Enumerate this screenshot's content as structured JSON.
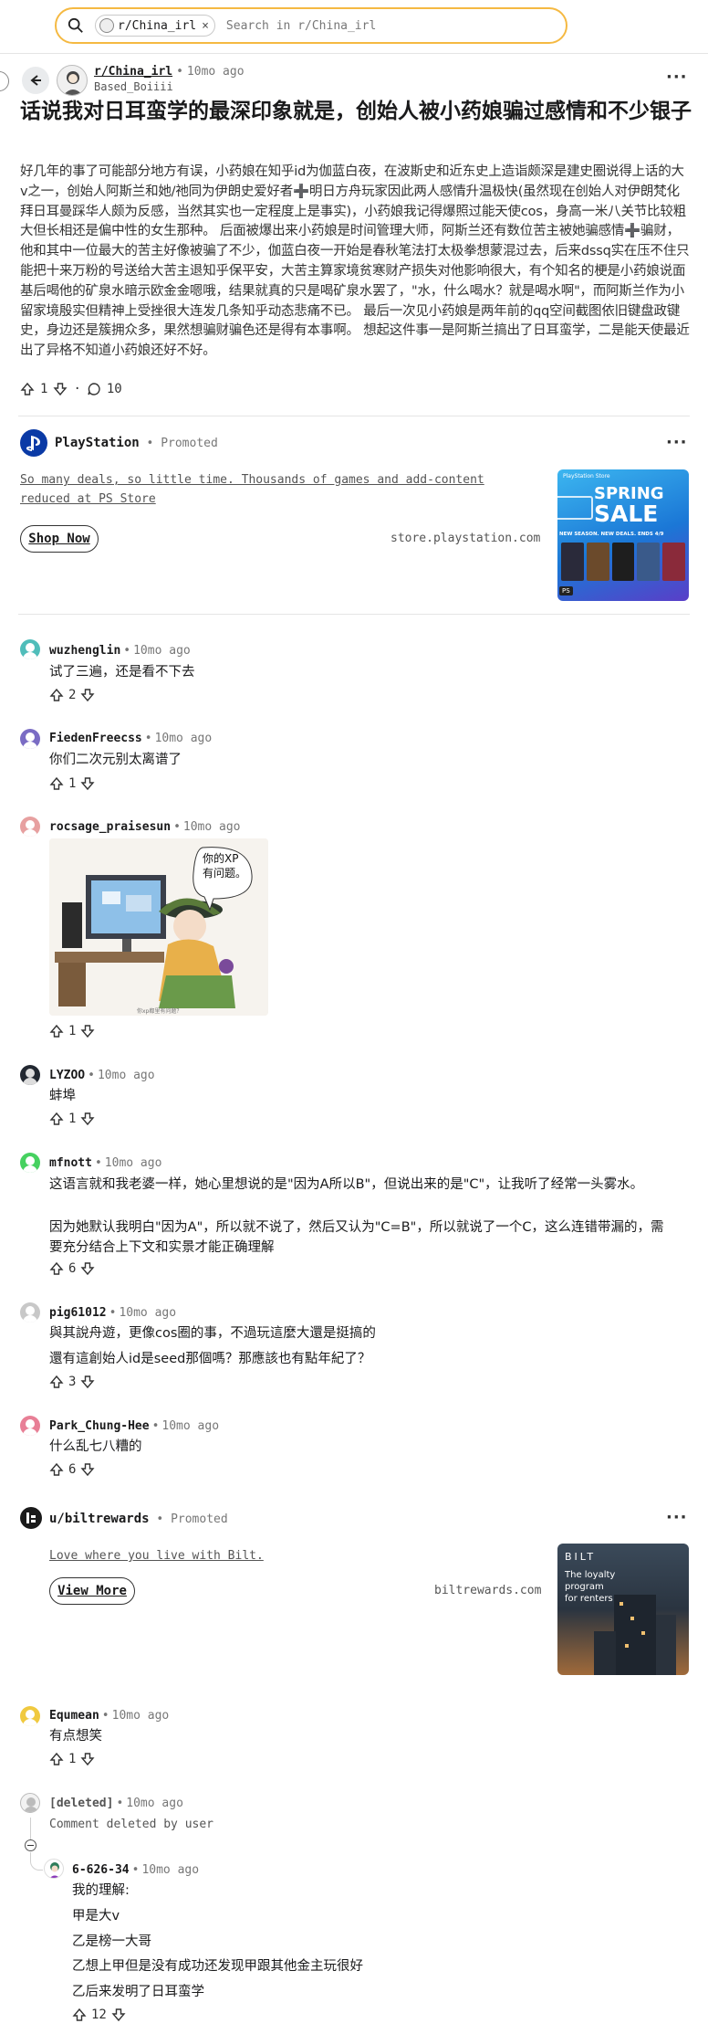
{
  "search": {
    "chip_label": "r/China_irl",
    "chip_close": "×",
    "placeholder": "Search in r/China_irl"
  },
  "post": {
    "subreddit": "r/China_irl",
    "time": "10mo ago",
    "author": "Based_Boiiii",
    "title": "话说我对日耳蛮学的最深印象就是，创始人被小药娘骗过感情和不少银子",
    "body": "好几年的事了可能部分地方有误，小药娘在知乎id为伽蓝白夜，在波斯史和近东史上造诣颇深是建史圈说得上话的大v之一，创始人阿斯兰和她/祂同为伊朗史爱好者➕明日方舟玩家因此两人感情升温极快(虽然现在创始人对伊朗梵化拜日耳曼踩华人颇为反感，当然其实也一定程度上是事实)，小药娘我记得爆照过能天使cos，身高一米八关节比较粗大但长相还是偏中性的女生那种。 后面被爆出来小药娘是时间管理大师，阿斯兰还有数位苦主被她骗感情➕骗财，他和其中一位最大的苦主好像被骗了不少，伽蓝白夜一开始是春秋笔法打太极拳想蒙混过去，后来dssq实在压不住只能把十来万粉的号送给大苦主退知乎保平安，大苦主算家境贫寒财产损失对他影响很大，有个知名的梗是小药娘说面基后喝他的矿泉水暗示欧金金嗯哦，结果就真的只是喝矿泉水罢了，\"水，什么喝水？就是喝水啊\"，而阿斯兰作为小留家境殷实但精神上受挫很大连发几条知乎动态悲痛不已。 最后一次见小药娘是两年前的qq空间截图依旧键盘政键史，身边还是簇拥众多，果然想骗财骗色还是得有本事啊。 想起这件事一是阿斯兰搞出了日耳蛮学，二是能天使最近出了异格不知道小药娘还好不好。",
    "upvotes": "1",
    "comments": "10",
    "separator": "·"
  },
  "ad_playstation": {
    "name": "PlayStation",
    "promoted": "Promoted",
    "text": "So many deals, so little time. Thousands of games and add-content reduced at PS Store",
    "button": "Shop Now",
    "domain": "store.playstation.com",
    "image": {
      "brand": "PlayStation Store",
      "headline_top": "SPRING",
      "headline_bottom": "SALE",
      "tag": "NEW SEASON. NEW DEALS. ENDS 4/9",
      "badge": "PS"
    }
  },
  "comments": [
    {
      "user": "wuzhenglin",
      "time": "10mo ago",
      "lines": [
        "试了三遍，还是看不下去"
      ],
      "votes": "2",
      "avatar_color": "#4fbdba"
    },
    {
      "user": "FiedenFreecss",
      "time": "10mo ago",
      "lines": [
        "你们二次元别太离谱了"
      ],
      "votes": "1",
      "avatar_color": "#7a6cc4"
    },
    {
      "user": "rocsage_praisesun",
      "time": "10mo ago",
      "lines": [],
      "votes": "1",
      "avatar_color": "#e7a0a0",
      "image_caption": "你的XP有问题。",
      "image_footer": "你xp都里有问题？"
    },
    {
      "user": "LYZOO",
      "time": "10mo ago",
      "lines": [
        "蚌埠"
      ],
      "votes": "1",
      "avatar_color": "#222831"
    },
    {
      "user": "mfnott",
      "time": "10mo ago",
      "lines": [
        "这语言就和我老婆一样，她心里想说的是\"因为A所以B\"，但说出来的是\"C\"，让我听了经常一头雾水。",
        "因为她默认我明白\"因为A\"，所以就不说了，然后又认为\"C=B\"，所以就说了一个C，这么连错带漏的，需要充分结合上下文和实景才能正确理解"
      ],
      "votes": "6",
      "avatar_color": "#46d160"
    },
    {
      "user": "pig61012",
      "time": "10mo ago",
      "lines": [
        "與其說舟遊，更像cos圈的事，不過玩這麼大還是挺搞的",
        "還有這創始人id是seed那個嗎？那應該也有點年紀了？"
      ],
      "votes": "3",
      "avatar_color": "#c8c8c8"
    },
    {
      "user": "Park_Chung-Hee",
      "time": "10mo ago",
      "lines": [
        "什么乱七八糟的"
      ],
      "votes": "6",
      "avatar_color": "#e87f96"
    }
  ],
  "ad_bilt": {
    "name": "u/biltrewards",
    "promoted": "Promoted",
    "text": "Love where you live with Bilt.",
    "button": "View More",
    "domain": "biltrewards.com",
    "image": {
      "brand": "BILT",
      "line1": "The loyalty",
      "line2": "program",
      "line3": "for renters"
    }
  },
  "comments2": [
    {
      "user": "Equmean",
      "time": "10mo ago",
      "lines": [
        "有点想笑"
      ],
      "votes": "1",
      "avatar_color": "#f0c93f"
    },
    {
      "user": "[deleted]",
      "time": "10mo ago",
      "lines": [
        "Comment deleted by user"
      ],
      "votes": "",
      "avatar_color": "#d9d9d9"
    },
    {
      "user": "6-626-34",
      "time": "10mo ago",
      "lines": [
        "我的理解:",
        "甲是大v",
        "乙是榜一大哥",
        "乙想上甲但是没有成功还发现甲跟其他金主玩很好",
        "乙后来发明了日耳蛮学"
      ],
      "votes": "12",
      "avatar_color": "#ffffff"
    }
  ],
  "colors": {
    "search_border": "#f5b942",
    "playstation_blue": "#0a3aa6",
    "bilt_dark": "#1d2630"
  },
  "icons": [
    "search-icon",
    "back-arrow-icon",
    "upvote-icon",
    "downvote-icon",
    "comment-icon",
    "more-icon",
    "collapse-icon"
  ]
}
